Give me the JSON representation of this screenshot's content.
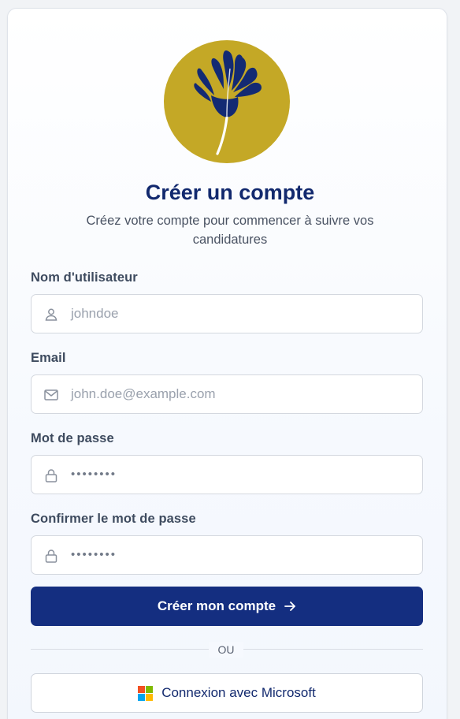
{
  "form": {
    "title": "Créer un compte",
    "subtitle": "Créez votre compte pour commencer à suivre vos candidatures",
    "username": {
      "label": "Nom d'utilisateur",
      "placeholder": "johndoe",
      "icon": "user-icon"
    },
    "email": {
      "label": "Email",
      "placeholder": "john.doe@example.com",
      "icon": "mail-icon"
    },
    "password": {
      "label": "Mot de passe",
      "value": "••••••••",
      "icon": "lock-icon"
    },
    "confirm_password": {
      "label": "Confirmer le mot de passe",
      "value": "••••••••",
      "icon": "lock-icon"
    },
    "submit_label": "Créer mon compte",
    "divider_label": "OU",
    "microsoft_label": "Connexion avec Microsoft"
  },
  "colors": {
    "brand_navy": "#142e80",
    "logo_gold": "#c4a826",
    "title": "#12296e"
  }
}
